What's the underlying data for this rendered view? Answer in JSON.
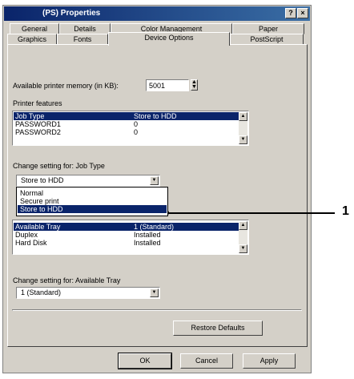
{
  "window": {
    "title": "(PS) Properties",
    "help_btn": "?",
    "close_btn": "×"
  },
  "tabs": {
    "row1": [
      "General",
      "Details",
      "Color Management",
      "Paper"
    ],
    "row2": [
      "Graphics",
      "Fonts",
      "Device Options",
      "PostScript"
    ],
    "active": "Device Options"
  },
  "memory": {
    "label": "Available printer memory (in KB):",
    "value": "5001",
    "spin_up": "▲",
    "spin_down": "▼"
  },
  "features": {
    "label": "Printer features",
    "rows_top": [
      {
        "name": "Job Type",
        "value": "Store to HDD"
      },
      {
        "name": "PASSWORD1",
        "value": "0"
      },
      {
        "name": "PASSWORD2",
        "value": "0"
      }
    ],
    "rows_bottom": [
      {
        "name": "Available Tray",
        "value": "1 (Standard)"
      },
      {
        "name": "Duplex",
        "value": "Installed"
      },
      {
        "name": "Hard Disk",
        "value": "Installed"
      }
    ]
  },
  "change_job": {
    "label": "Change setting for:  Job Type",
    "selected": "Store to HDD",
    "options": [
      "Normal",
      "Secure print",
      "Store to HDD"
    ]
  },
  "change_tray": {
    "label": "Change setting for:  Available Tray",
    "selected": "1 (Standard)"
  },
  "buttons": {
    "restore": "Restore Defaults",
    "ok": "OK",
    "cancel": "Cancel",
    "apply": "Apply"
  },
  "callout": {
    "number": "1"
  },
  "icons": {
    "up": "▲",
    "down": "▼"
  }
}
